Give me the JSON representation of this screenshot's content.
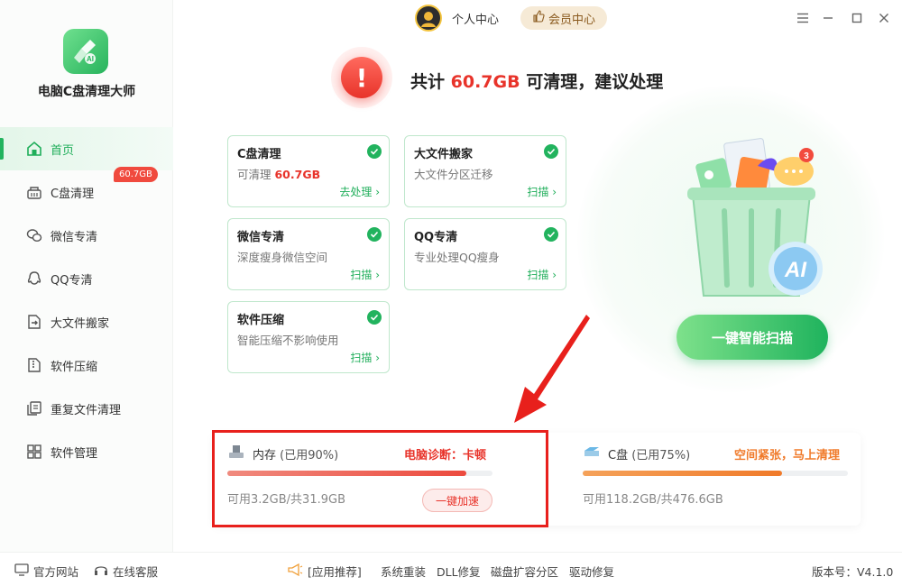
{
  "app": {
    "name": "电脑C盘清理大师"
  },
  "sidebar": {
    "items": [
      {
        "label": "首页",
        "icon": "home-icon",
        "active": true
      },
      {
        "label": "C盘清理",
        "icon": "broom-icon",
        "badge": "60.7GB"
      },
      {
        "label": "微信专清",
        "icon": "wechat-icon"
      },
      {
        "label": "QQ专清",
        "icon": "qq-icon"
      },
      {
        "label": "大文件搬家",
        "icon": "file-move-icon"
      },
      {
        "label": "软件压缩",
        "icon": "compress-icon"
      },
      {
        "label": "重复文件清理",
        "icon": "duplicate-file-icon"
      },
      {
        "label": "软件管理",
        "icon": "apps-icon"
      }
    ]
  },
  "topbar": {
    "personal_label": "个人中心",
    "vip_label": "会员中心"
  },
  "header": {
    "prefix": "共计 ",
    "amount": "60.7GB",
    "suffix": " 可清理，建议处理"
  },
  "cards": [
    {
      "title": "C盘清理",
      "desc_prefix": "可清理 ",
      "desc_value": "60.7GB",
      "link": "去处理 ›"
    },
    {
      "title": "大文件搬家",
      "desc": "大文件分区迁移",
      "link": "扫描 ›"
    },
    {
      "title": "微信专清",
      "desc": "深度瘦身微信空间",
      "link": "扫描 ›"
    },
    {
      "title": "QQ专清",
      "desc": "专业处理QQ瘦身",
      "link": "扫描 ›"
    },
    {
      "title": "软件压缩",
      "desc": "智能压缩不影响使用",
      "link": "扫描 ›"
    }
  ],
  "illustration": {
    "badge_count": "3",
    "ai_label": "AI"
  },
  "scan_button": "一键智能扫描",
  "memory": {
    "name": "内存",
    "used": "(已用90%)",
    "used_fraction": 0.9,
    "diagnosis": "电脑诊断：卡顿",
    "detail": "可用3.2GB/共31.9GB",
    "action": "一键加速",
    "color": "#f0625a"
  },
  "disk": {
    "name": "C盘",
    "used": "(已用75%)",
    "used_fraction": 0.75,
    "diagnosis": "空间紧张，马上清理",
    "detail": "可用118.2GB/共476.6GB",
    "color": "#f07a2a"
  },
  "footer": {
    "website": "官方网站",
    "service": "在线客服",
    "links": [
      "[应用推荐]",
      "系统重装",
      "DLL修复",
      "磁盘扩容分区",
      "驱动修复"
    ],
    "version": "版本号：V4.1.0"
  },
  "colors": {
    "accent": "#22b35e",
    "alert": "#e8332a",
    "vip": "#f6ead6"
  }
}
